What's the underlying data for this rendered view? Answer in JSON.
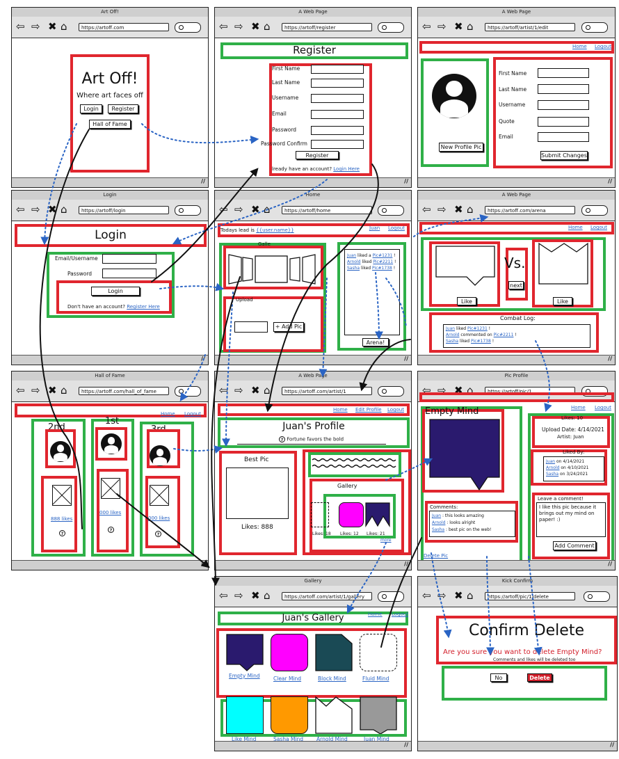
{
  "colors": {
    "annotation_red": "#e0262e",
    "annotation_green": "#2fb048",
    "link_blue": "#2a64c4",
    "purple": "#2a1a6e",
    "magenta": "#ff00ff",
    "teal": "#1a4a55",
    "cyan": "#00ffff",
    "orange": "#ff9900",
    "gray": "#999999",
    "delete_red": "#d21e2a"
  },
  "icons": {
    "back": "arrow-left-icon",
    "forward": "arrow-right-icon",
    "stop": "x-icon",
    "home": "home-icon",
    "search": "search-icon",
    "avatar": "user-avatar-icon",
    "help": "question-icon",
    "resize": "resize-grip-icon"
  },
  "w1": {
    "title": "Art Off!",
    "url": "https://artoff.com",
    "app_title": "Art Off!",
    "tagline": "Where art faces off",
    "login": "Login",
    "register": "Register",
    "hall": "Hall of Fame"
  },
  "w2": {
    "title": "A Web Page",
    "url": "https://artoff/register",
    "heading": "Register",
    "fields": [
      "First Name",
      "Last Name",
      "Username",
      "Email",
      "Password",
      "Password Confirm"
    ],
    "submit": "Register",
    "already": "lready have an account?",
    "login_link": "Login Here"
  },
  "w3": {
    "title": "A Web Page",
    "url": "https://artoff/artist/1/edit",
    "home": "Home",
    "logout": "Logout",
    "new_pic": "New Profile Pic",
    "fields": [
      "First Name",
      "Last Name",
      "Username",
      "Quote",
      "Email"
    ],
    "submit": "Submit Changes"
  },
  "w4": {
    "title": "Login",
    "url": "https://artoff/login",
    "heading": "Login",
    "email_label": "Email/Username",
    "password_label": "Password",
    "submit": "Login",
    "no_account": "Don't have an account?",
    "register_link": "Register Here"
  },
  "w5": {
    "title": "Home",
    "url": "https://artoff/home",
    "lead_text": "Todays lead is",
    "lead_user": "{{user.name}}",
    "user_link": "Juan",
    "logout": "Logout",
    "gallery_label": "Galle",
    "upload_label": "Upload",
    "add_pic": "+ Add Pic",
    "feed": [
      {
        "user": "Juan",
        "text": "liked a",
        "pic": "Pic#1231"
      },
      {
        "user": "Arnold",
        "text": "liked",
        "pic": "Pic#2211"
      },
      {
        "user": "Sasha",
        "text": "liked",
        "pic": "Pic#1738"
      }
    ],
    "arena": "Arena!"
  },
  "w6": {
    "title": "A Web Page",
    "url": "https://artoff.com/arena",
    "home": "Home",
    "logout": "Logout",
    "vs": "Vs.",
    "next": "next",
    "like1": "Like",
    "like2": "Like",
    "log_title": "Combat Log:",
    "log": [
      {
        "user": "Juan",
        "text": "liked",
        "pic": "Pic#1231"
      },
      {
        "user": "Arnold",
        "text": "commented on",
        "pic": "Pic#2211"
      },
      {
        "user": "Sasha",
        "text": "liked",
        "pic": "Pic#1738"
      }
    ]
  },
  "w7": {
    "title": "Hall of Fame",
    "url": "https://artoff.com/hall_of_fame",
    "home": "Home",
    "logout": "Logout",
    "ranks": [
      {
        "place": "2nd",
        "likes": "888 likes"
      },
      {
        "place": "1st",
        "likes": "000 likes"
      },
      {
        "place": "3rd",
        "likes": "000 likes"
      }
    ]
  },
  "w8": {
    "title": "A Web Page",
    "url": "https://artoff.com/artist/1",
    "home": "Home",
    "edit": "Edit Profile",
    "logout": "Logout",
    "heading": "Juan's Profile",
    "quote": "Fortune favors the bold",
    "best_pic": "Best Pic",
    "best_likes": "Likes: 888",
    "gallery": "Gallery",
    "likes": [
      "Likes: 18",
      "Likes: 12",
      "Likes: 21"
    ],
    "more": "more"
  },
  "w9": {
    "title": "Pic Profile",
    "url": "https://artoff/pic/1",
    "home": "Home",
    "logout": "Logout",
    "pic_name": "Empty Mind",
    "likes": "Likes: 10",
    "upload": "Upload Date: 4/14/2021",
    "artist": "Artist: Juan",
    "liked_by_title": "Liked By:",
    "liked_by": [
      {
        "user": "Juan",
        "text": "on 4/14/2021"
      },
      {
        "user": "Arnold",
        "text": "on 4/10/2021"
      },
      {
        "user": "Sasha",
        "text": "on 3/24/2021"
      }
    ],
    "comments_title": "Comments:",
    "comments": [
      {
        "user": "Juan",
        "text": ": this looks amazing"
      },
      {
        "user": "Arnold",
        "text": ": looks alright"
      },
      {
        "user": "Sasha",
        "text": ": best pic on the web!"
      }
    ],
    "leave_title": "Leave a comment!",
    "comment_text": "I like this pic because it brings out my mind on paper! :)",
    "add_comment": "Add Comment",
    "delete": "Delete Pic"
  },
  "w10": {
    "title": "Gallery",
    "url": "https://artoff.com/artist/1/gallery",
    "home": "Home",
    "logout": "Logout",
    "heading": "Juan's Gallery",
    "pics": [
      "Empty Mind",
      "Clear Mind",
      "Block Mind",
      "Fluid Mind",
      "Like Mind",
      "Sasha Mind",
      "Arnold Mind",
      "Juan Mind"
    ]
  },
  "w11": {
    "title": "Kick Confirm",
    "url": "https://artoff/pic/1/delete",
    "heading": "Confirm Delete",
    "question": "Are you sure you want to delete Empty Mind?",
    "note": "Comments and likes will be deleted too",
    "no": "No",
    "delete": "Delete"
  }
}
